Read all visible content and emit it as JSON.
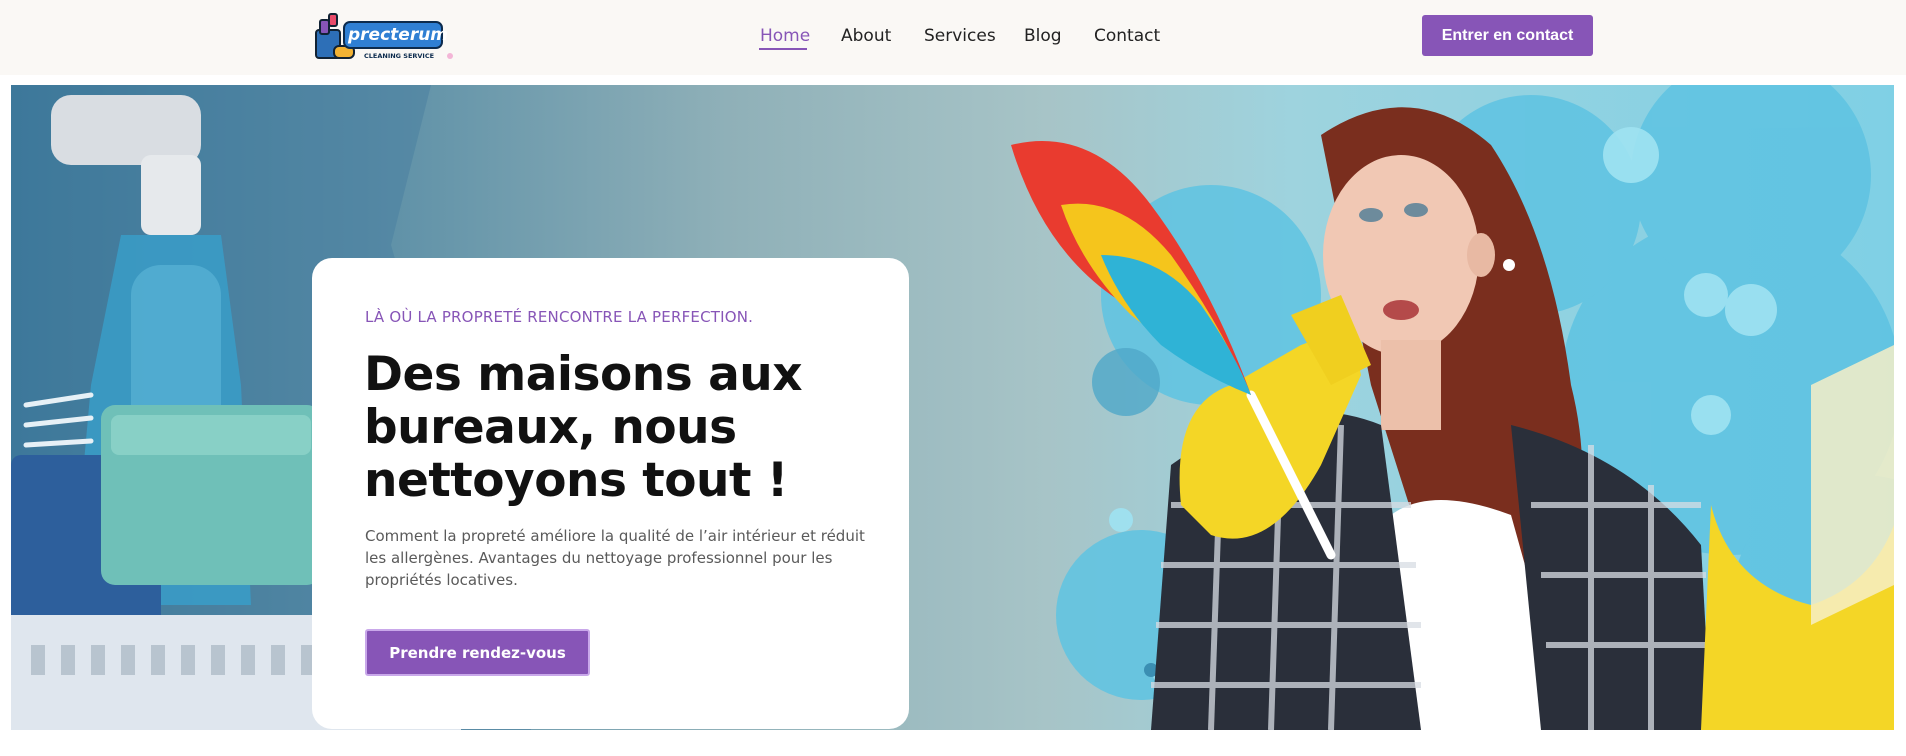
{
  "header": {
    "logo": {
      "brand": "precterum",
      "tagline": "CLEANING SERVICE",
      "icon": "cleaning-supplies-icon"
    },
    "nav": [
      {
        "label": "Home",
        "active": true
      },
      {
        "label": "About",
        "active": false
      },
      {
        "label": "Services",
        "active": false
      },
      {
        "label": "Blog",
        "active": false
      },
      {
        "label": "Contact",
        "active": false
      }
    ],
    "cta_label": "Entrer en contact"
  },
  "hero": {
    "eyebrow": "LÀ OÙ LA PROPRETÉ RENCONTRE LA PERFECTION.",
    "headline": "Des maisons aux bureaux, nous nettoyons tout !",
    "description": "Comment la propreté améliore la qualité de l’air intérieur et réduit les allergènes. Avantages du nettoyage professionnel pour les propriétés locatives.",
    "cta_label": "Prendre rendez-vous",
    "background_image": "woman-with-feather-duster-and-cleaning-supplies"
  },
  "colors": {
    "accent": "#8755b7",
    "header_bg": "#faf8f5",
    "heading": "#111111",
    "body_text": "#5a5a5a"
  }
}
